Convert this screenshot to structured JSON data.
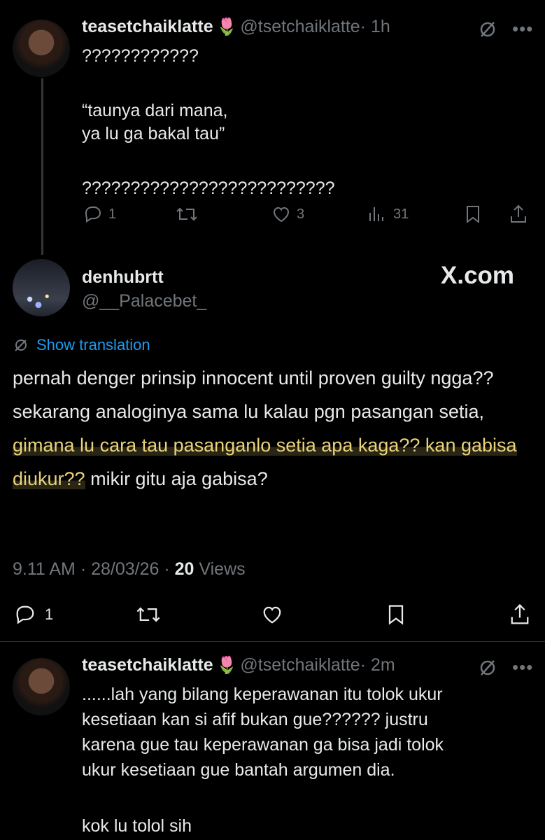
{
  "tweet1": {
    "name": "teasetchaiklatte",
    "emoji": "🌷",
    "handle": "@tsetchaiklatte",
    "time": "· 1h",
    "lines": [
      "????????????",
      "",
      "“taunya dari mana,",
      "ya lu ga bakal tau”",
      "",
      "??????????????????????????"
    ],
    "reply_count": "1",
    "like_count": "3",
    "view_count": "31"
  },
  "main": {
    "name": "denhubrtt",
    "handle": "@__Palacebet_",
    "watermark": "X.com",
    "show_translation": "Show translation",
    "text_before": "pernah denger prinsip innocent until proven guilty ngga?? sekarang analoginya sama lu kalau pgn pasangan setia, ",
    "text_highlight": "gimana lu cara tau pasanganlo setia apa kaga?? kan gabisa diukur??",
    "text_after": " mikir gitu aja gabisa?",
    "time": "9.11 AM",
    "date": "28/03/26",
    "views_count": "20",
    "views_label": "Views",
    "reply_count": "1"
  },
  "tweet3": {
    "name": "teasetchaiklatte",
    "emoji": "🌷",
    "handle": "@tsetchaiklatte",
    "time": "· 2m",
    "lines": [
      "......lah yang bilang keperawanan itu tolok ukur",
      "kesetiaan kan si afif bukan gue?????? justru",
      "karena gue tau keperawanan ga bisa jadi tolok",
      "ukur kesetiaan gue bantah argumen dia.",
      "",
      "kok lu tolol sih"
    ]
  },
  "colors": {
    "background": "#000000",
    "text": "#e7e9ea",
    "muted": "#71767b",
    "link": "#1d9bf0",
    "highlight": "#e8d27a"
  }
}
